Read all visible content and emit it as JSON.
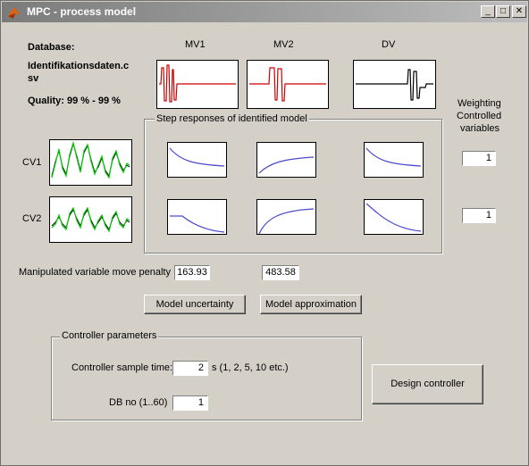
{
  "window": {
    "title": "MPC - process model",
    "minimize": "_",
    "maximize": "□",
    "close": "✕"
  },
  "info": {
    "database_label": "Database:",
    "database_value_l1": "Identifikationsdaten.c",
    "database_value_l2": "sv",
    "quality": "Quality: 99 % - 99 %"
  },
  "inputs": {
    "mv1": "MV1",
    "mv2": "MV2",
    "dv": "DV"
  },
  "outputs": {
    "cv1": "CV1",
    "cv2": "CV2"
  },
  "step_panel": {
    "title": "Step responses of identified model"
  },
  "weighting": {
    "l1": "Weighting",
    "l2": "Controlled",
    "l3": "variables",
    "cv1": "1",
    "cv2": "1"
  },
  "penalty": {
    "label": "Manipulated variable move penalty",
    "mv1": "163.93",
    "mv2": "483.58"
  },
  "buttons": {
    "uncertainty": "Model uncertainty",
    "approximation": "Model approximation",
    "design": "Design controller"
  },
  "controller": {
    "title": "Controller parameters",
    "sample_label": "Controller sample time:",
    "sample_value": "2",
    "sample_hint": "s (1, 2, 5, 10 etc.)",
    "db_label": "DB no (1..60)",
    "db_value": "1"
  },
  "colors": {
    "mv_trace": "#cc0000",
    "dv_trace": "#000000",
    "cv_measured": "#00cc00",
    "cv_model": "#000000",
    "step_curve": "#4a4ad0"
  }
}
